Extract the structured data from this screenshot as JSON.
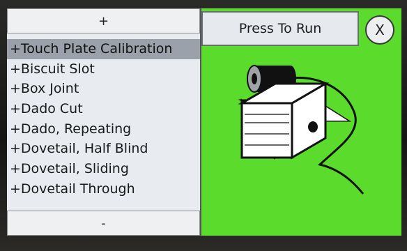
{
  "list": {
    "scroll_up_label": "+",
    "scroll_down_label": "-",
    "items": [
      "+Touch Plate Calibration",
      "+Biscuit Slot",
      "+Box Joint",
      "+Dado Cut",
      "+Dado, Repeating",
      "+Dovetail, Half Blind",
      "+Dovetail, Sliding",
      "+Dovetail Through"
    ],
    "selected_index": 0
  },
  "run_panel": {
    "run_label": "Press To Run",
    "close_label": "X"
  },
  "colors": {
    "run_panel_bg": "#5bdc2c",
    "list_bg": "#e8ebef",
    "selected_bg": "#9aa1ab"
  }
}
